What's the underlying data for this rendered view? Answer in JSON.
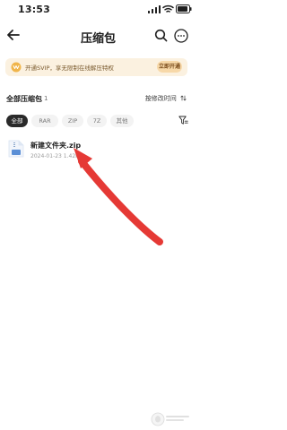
{
  "status_bar": {
    "time": "13:53",
    "icons": [
      "signal-icon",
      "wifi-icon",
      "battery-icon"
    ]
  },
  "nav": {
    "title": "压缩包",
    "left_icon": "back-icon",
    "right_icons": [
      "search-icon",
      "more-icon"
    ]
  },
  "vip_banner": {
    "text": "开通SVIP，享无限制在线解压特权",
    "button": "立即开通",
    "icon": "vip-icon",
    "colors": {
      "background": "#fbf1e0",
      "button_background": "#f7d8a8",
      "text": "#7a5a2e"
    }
  },
  "list_header": {
    "title": "全部压缩包",
    "count": "1",
    "sort": "按修改时间",
    "sort_icon": "sort-arrows-icon"
  },
  "filters": {
    "chips": [
      "全部",
      "RAR",
      "ZIP",
      "7Z",
      "其他"
    ],
    "selected": "全部",
    "filter_icon": "filter-icon"
  },
  "files": [
    {
      "name": "新建文件夹.zip",
      "date": "2024-01-23",
      "size": "1.42MB",
      "icon": "zip-file-icon"
    }
  ],
  "annotation": {
    "type": "arrow",
    "color": "#e53935",
    "points_to": "file-item"
  }
}
